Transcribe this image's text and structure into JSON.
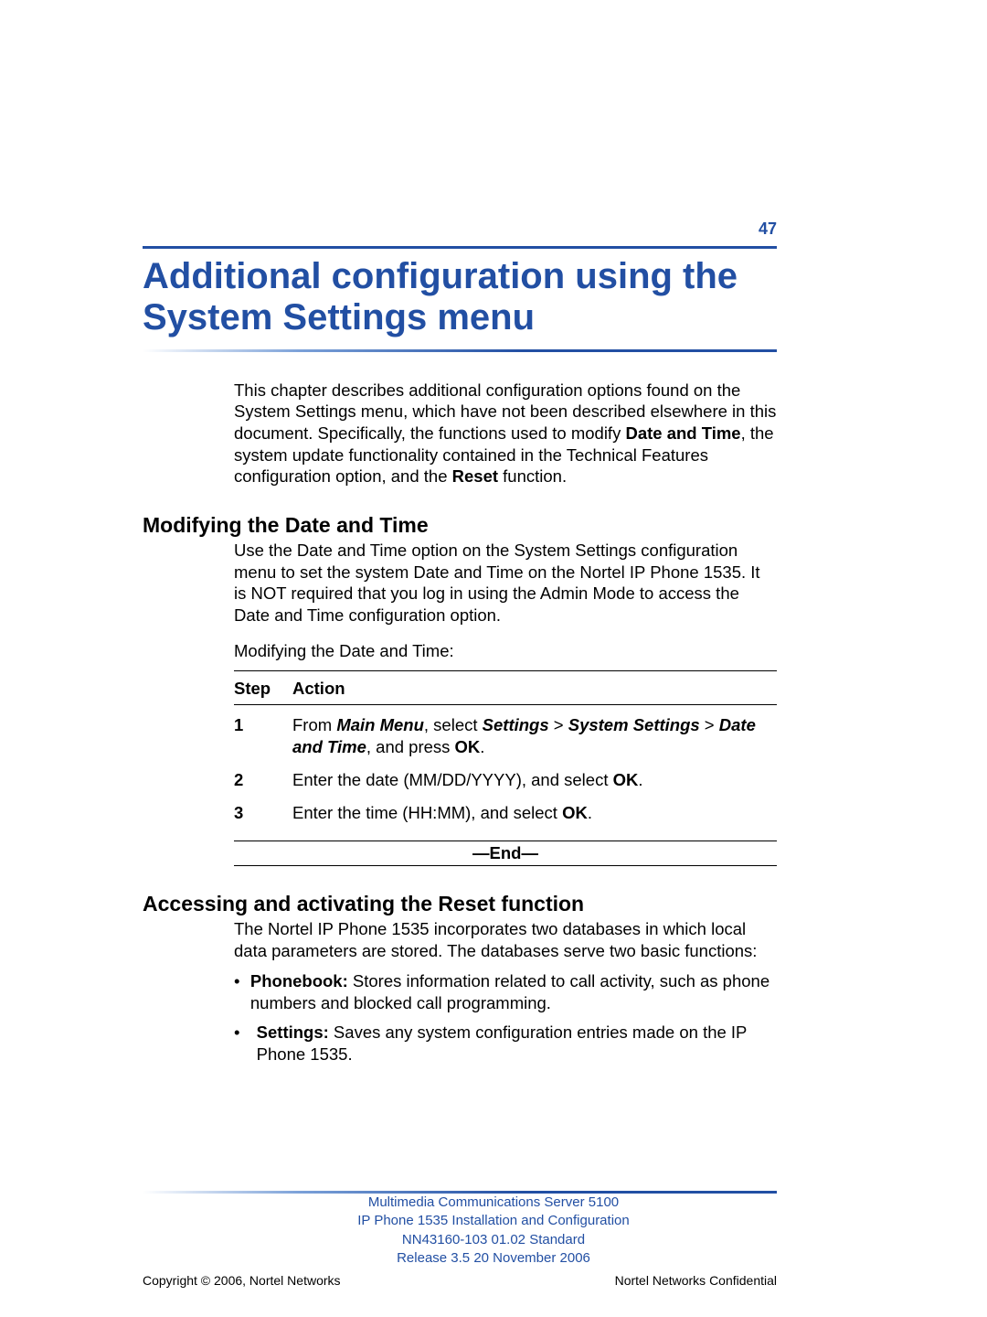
{
  "page_number": "47",
  "title": "Additional configuration using the System Settings menu",
  "intro": {
    "t1": "This chapter describes additional configuration options found on the System Settings menu, which have not been described elsewhere in this document. Specifically, the functions used to modify ",
    "b1": "Date and Time",
    "t2": ", the system update functionality contained in the Technical Features configuration option, and the ",
    "b2": "Reset",
    "t3": " function."
  },
  "sec1": {
    "heading": "Modifying the Date and Time",
    "body": "Use the Date and Time option on the System Settings configuration menu to set the system Date and Time on the Nortel IP Phone 1535. It is NOT required that you log in using the Admin Mode to access the Date and Time configuration option.",
    "lead": "Modifying the Date and Time:",
    "col_step": "Step",
    "col_action": "Action",
    "steps": [
      {
        "n": "1",
        "p1": "From ",
        "b1": "Main Menu",
        "p2": ", select ",
        "bi1": "Settings",
        "gt1": " > ",
        "bi2": "System Settings",
        "gt2": " > ",
        "bi3": "Date and Time",
        "p3": ", and press ",
        "b2": "OK",
        "p4": "."
      },
      {
        "n": "2",
        "p1": "Enter the date (MM/DD/YYYY), and select ",
        "b1": "OK",
        "p2": "."
      },
      {
        "n": "3",
        "p1": "Enter the time (HH:MM), and select ",
        "b1": "OK",
        "p2": "."
      }
    ],
    "end": "—End—"
  },
  "sec2": {
    "heading": "Accessing and activating the Reset function",
    "body": "The Nortel IP Phone 1535 incorporates two databases in which local data parameters are stored. The databases serve two basic functions:",
    "bullets": [
      {
        "b": "Phonebook:",
        "t": " Stores information related to call activity, such as phone numbers and blocked call programming."
      },
      {
        "b": "Settings:",
        "t": " Saves any system configuration entries made on the IP Phone 1535."
      }
    ]
  },
  "footer": {
    "l1": "Multimedia Communications Server 5100",
    "l2": "IP Phone 1535 Installation and Configuration",
    "l3": "NN43160-103   01.02   Standard",
    "l4": "Release 3.5   20 November 2006",
    "left": "Copyright © 2006, Nortel Networks",
    "right": "Nortel Networks Confidential"
  }
}
